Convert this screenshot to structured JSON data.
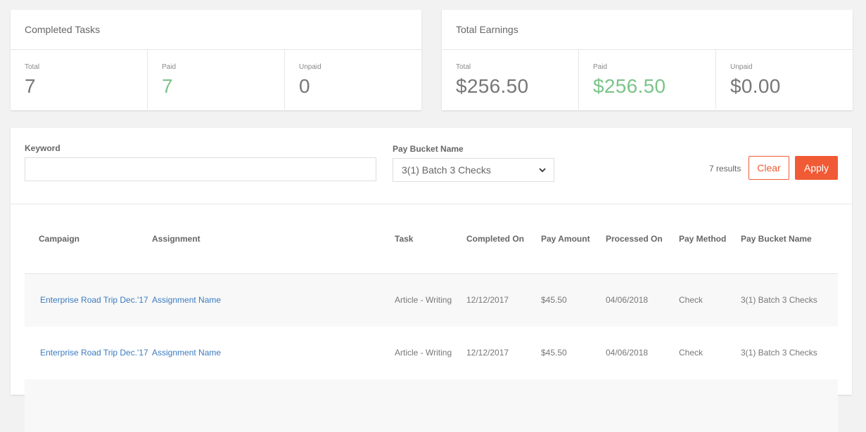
{
  "completed_tasks": {
    "title": "Completed Tasks",
    "stats": [
      {
        "label": "Total",
        "value": "7"
      },
      {
        "label": "Paid",
        "value": "7"
      },
      {
        "label": "Unpaid",
        "value": "0"
      }
    ]
  },
  "total_earnings": {
    "title": "Total Earnings",
    "stats": [
      {
        "label": "Total",
        "value": "$256.50"
      },
      {
        "label": "Paid",
        "value": "$256.50"
      },
      {
        "label": "Unpaid",
        "value": "$0.00"
      }
    ]
  },
  "filters": {
    "keyword_label": "Keyword",
    "keyword_value": "",
    "keyword_placeholder": "",
    "bucket_label": "Pay Bucket Name",
    "bucket_selected": "3(1) Batch 3 Checks",
    "results_count": "7 results",
    "clear_label": "Clear",
    "apply_label": "Apply"
  },
  "colors": {
    "accent": "#f05a35",
    "paid_green": "#7cc48a",
    "link_blue": "#3b7bbf"
  },
  "table": {
    "headers": [
      "Campaign",
      "Assignment",
      "Task",
      "Completed On",
      "Pay Amount",
      "Processed On",
      "Pay Method",
      "Pay Bucket Name"
    ],
    "rows": [
      {
        "campaign": "Enterprise Road Trip Dec.'17",
        "assignment": "Assignment Name",
        "task": "Article - Writing",
        "completed_on": "12/12/2017",
        "pay_amount": "$45.50",
        "processed_on": "04/06/2018",
        "pay_method": "Check",
        "pay_bucket": "3(1) Batch 3 Checks"
      },
      {
        "campaign": "Enterprise Road Trip Dec.'17",
        "assignment": "Assignment Name",
        "task": "Article - Writing",
        "completed_on": "12/12/2017",
        "pay_amount": "$45.50",
        "processed_on": "04/06/2018",
        "pay_method": "Check",
        "pay_bucket": "3(1) Batch 3 Checks"
      }
    ]
  }
}
